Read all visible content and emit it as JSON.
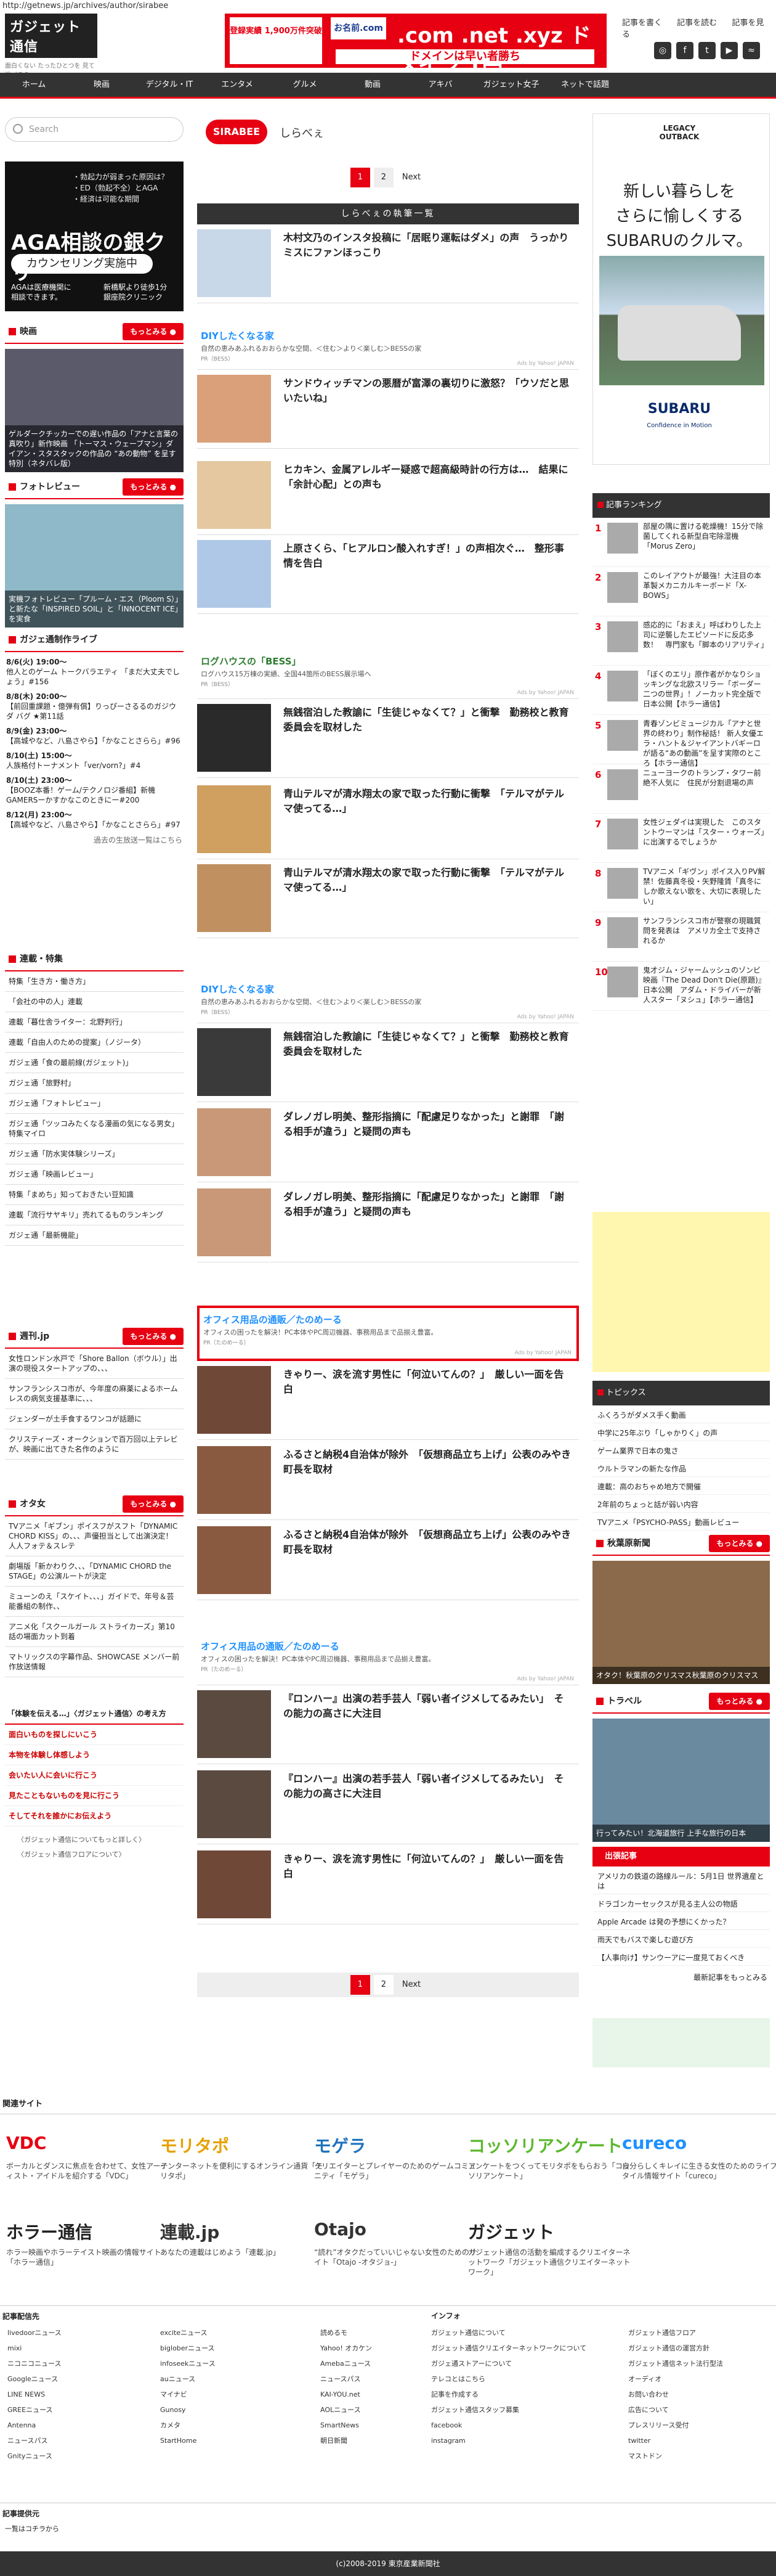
{
  "url": "http://getnews.jp/archives/author/sirabee",
  "logo": {
    "name": "ガジェット通信",
    "tagline": "面白くない たったひとつを 見て過ごそう"
  },
  "top_banner": {
    "left": "登録実績 1,900万件突破",
    "brand": "お名前.com",
    "domains": ".com .net .xyz ドメイン 1円",
    "sub": "ドメインは早い者勝ち"
  },
  "top_links": [
    "記事を書く",
    "記事を読む",
    "記事を見る"
  ],
  "social": [
    "instagram",
    "facebook",
    "twitter",
    "feed"
  ],
  "nav": [
    "ホーム",
    "映画",
    "デジタル・IT",
    "エンタメ",
    "グルメ",
    "動画",
    "アキバ",
    "ガジェット女子",
    "ネットで話題"
  ],
  "search_placeholder": "Search",
  "ad_left": {
    "lines": "・勃起力が弱まった原因は？\n・ED（勃起不全）とAGA\n・経済は可能な期間",
    "title": "AGA相談の銀クリ",
    "button": "カウンセリング実施中",
    "bottom_left": "AGAは医療機関に\n相談できます。",
    "bottom_right": "新橋駅より徒歩1分\n銀座院クリニック"
  },
  "left": {
    "movie_hdr": "映画",
    "more": "もっとみる",
    "movie_cap": "ゲルダークチッカーでの遅い作品の「アナと言葉の真吹り」新作映画 「トーマス・ウェーブマン」ダイアン・スタスタックの作品の “あの動物” を呈す 特別（ネタバレ版）",
    "photo_hdr": "フォトレビュー",
    "photo_cap": "実機フォトレビュー「プルーム・エス（Ploom S）」と新たな「INSPIRED SOIL」と「INNOCENT ICE」を実食",
    "live_hdr": "ガジェ通制作ライブ",
    "live": [
      {
        "d": "8/6(火) 19:00〜",
        "t": "他人とのゲーム トークバラエティ 「まだ大丈夫でしょう」#156"
      },
      {
        "d": "8/8(木) 20:00〜",
        "t": "【前回重課題・億弾有償】りっぴーさるるのガジウダ バグ ★第11話"
      },
      {
        "d": "8/9(金) 23:00〜",
        "t": "【高城やなど、八島さやら】「かなことさらら」#96"
      },
      {
        "d": "8/10(土) 15:00〜",
        "t": "人族格付トーナメント「ver/vorn?」#4"
      },
      {
        "d": "8/10(土) 23:00〜",
        "t": "【BOOZ本番！ゲーム/テクノロジ番組】新機 GAMERSーかすかなこのときにー#200"
      },
      {
        "d": "8/12(月) 23:00〜",
        "t": "【高城やなど、八島さやら】「かなことさらら」#97"
      }
    ],
    "live_more": "過去の生放送一覧はこちら",
    "series_hdr": "連載・特集",
    "series": [
      "特集「生き方・働き方」",
      "「会社の中の人」連載",
      "連載「暮仕舎ライター：北野判行」",
      "連載「自由人のための提案」（ノジータ）",
      "ガジェ通「食の最前線(ガジェット)」",
      "ガジェ通「旅野村」",
      "ガジェ通「フォトレビュー」",
      "ガジェ通「ツッコみたくなる漫画の気になる男女」特集マイロ",
      "ガジェ通「防水実体験シリーズ」",
      "ガジェ通「映画レビュー」",
      "特集「まめち」知っておきたい豆知識",
      "連載「流行サヤキリ」売れてるものランキング",
      "ガジェ通「最新機能」"
    ],
    "news_hdr": "週刊.jp",
    "news": [
      "女性ロンドン水戸で「Shore Ballon（ボウル）」出演の現役スタートアップの、、、",
      "サンフランシスコ市が、今年度の麻薬によるホームレスの病気支援基準に、、、",
      "ジェンダーが土手食するワンコが話題に",
      "クリスティーズ・オークションで百万回以上テレビが、映画に出てきた名作のように"
    ],
    "otaku_hdr": "オタ女",
    "otaku": [
      "TVアニメ「ギブン」ポイスフがスフト「DYNAMIC CHORD KISS」の、、、声優担当として出演決定！人人フォテ＆スレテ",
      "劇場版「新かわりク、、、「DYNAMIC CHORD the STAGE」の公演ルートが決定",
      "ミューンのえ「スケイト、、、」ガイドで、年号＆芸能番組の制作、、",
      "アニメ化「スクールガール ストライカーズ」第10話の場面カット到着",
      "マトリックスの字幕作品、SHOWCASE メンバー前作放送情報"
    ],
    "reason_hdr": "「体験を伝える…」〈ガジェット通信〉の考え方",
    "reason": [
      "面白いものを探しにいこう",
      "本物を体験し体感しよう",
      "会いたい人に会いに行こう",
      "見たこともないものを見に行こう",
      "そしてそれを誰かにお伝えよう"
    ],
    "more_links": [
      "〈ガジェット通信についてもっと詳しく〉",
      "〈ガジェット通信フロアについて〉"
    ]
  },
  "center": {
    "sirabee_logo": "SIRABEE",
    "sirabee_name": "しらべぇ",
    "pager": {
      "cur": "1",
      "p2": "2",
      "next": "Next"
    },
    "author_title": "しらべぇの執筆一覧",
    "ad1": {
      "title": "DIYしたくなる家",
      "desc": "自然の恵みあふれるおおらかな空間、＜住む＞より＜楽しむ＞BESSの家",
      "sponsor": "PR（BESS）",
      "adtag": "Ads by Yahoo! JAPAN"
    },
    "ad2": {
      "title": "ログハウスの「BESS」",
      "desc": "ログハウス15万棟の実績、全国44箇所のBESS展示場へ",
      "sponsor": "PR（BESS）",
      "adtag": "Ads by Yahoo! JAPAN"
    },
    "ad3": {
      "title": "DIYしたくなる家",
      "desc": "自然の恵みあふれるおおらかな空間、＜住む＞より＜楽しむ＞BESSの家",
      "sponsor": "PR（BESS）",
      "adtag": "Ads by Yahoo! JAPAN"
    },
    "ad4": {
      "title": "オフィス用品の通販／たのめーる",
      "desc": "オフィスの困ったを解決！PC本体やPC周辺機器、事務用品まで品揃え豊富。",
      "sponsor": "PR（たのめーる）",
      "adtag": "Ads by Yahoo! JAPAN"
    },
    "ad5": {
      "title": "オフィス用品の通販／たのめーる",
      "desc": "オフィスの困ったを解決！PC本体やPC周辺機器、事務用品まで品揃え豊富。",
      "sponsor": "PR（たのめーる）",
      "adtag": "Ads by Yahoo! JAPAN"
    },
    "articles": [
      "木村文乃のインスタ投稿に「居眠り運転はダメ」の声　うっかりミスにファンほっこり",
      "サンドウィッチマンの悪暦が富澤の裏切りに激怒？「ウソだと思いたいね」",
      "ヒカキン、金属アレルギー疑惑で超高級時計の行方は…　結果に「余計心配」との声も",
      "上原さくら、「ヒアルロン酸入れすぎ！」の声相次ぐ…　整形事情を告白",
      "無銭宿泊した教諭に「生徒じゃなくて？」と衝撃　勤務校と教育委員会を取材した",
      "青山テルマが清水翔太の家で取った行動に衝撃　「テルマがテルマ使ってる…」",
      "青山テルマが清水翔太の家で取った行動に衝撃　「テルマがテルマ使ってる…」",
      "無銭宿泊した教諭に「生徒じゃなくて？」と衝撃　勤務校と教育委員会を取材した",
      "ダレノガレ明美、整形指摘に「配慮足りなかった」と謝罪　「謝る相手が違う」と疑問の声も",
      "ダレノガレ明美、整形指摘に「配慮足りなかった」と謝罪　「謝る相手が違う」と疑問の声も",
      "きゃりー、涙を流す男性に「何泣いてんの？」　厳しい一面を告白",
      "ふるさと納税4自治体が除外　「仮想商品立ち上げ」公表のみやき町長を取材",
      "ふるさと納税4自治体が除外　「仮想商品立ち上げ」公表のみやき町長を取材",
      "『ロンハー』出演の若手芸人「弱い者イジメしてるみたい」　その能力の高さに大注目",
      "『ロンハー』出演の若手芸人「弱い者イジメしてるみたい」　その能力の高さに大注目",
      "きゃりー、涙を流す男性に「何泣いてんの？」　厳しい一面を告白"
    ]
  },
  "right": {
    "ad": {
      "top": "LEGACY OUTBACK",
      "main": "新しい暮らしを\nさらに愉しくする\nSUBARUのクルマ。",
      "brand": "SUBARU",
      "slogan": "Confidence in Motion"
    },
    "rank_hdr": "記事ランキング",
    "ranking": [
      "部屋の隅に置ける乾燥機！15分で除菌してくれる新型自宅除湿機「Morus Zero」",
      "このレイアウトが最強！大注目の本革製メカニカルキーボード「X-BOWS」",
      "感応的に「おまえ」呼ばわりした上司に逆襲したエピソードに反応多数！　専門家も「脚本のリアリティ」",
      "「ぼくのエリ」原作者がかなりショッキングな北欧スリラー「ボーダー　二つの世界」！ノーカット完全版で日本公開【ホラー通信】",
      "青春ゾンビミュージカル「アナと世界の終わり」制作秘話！ 新人女優エラ・ハント＆ジャイアントバギーロが語る“あの動画”を呈す実際のところ【ホラー通信】",
      "ニューヨークのトランプ・タワー前絶不人気に　住民が分割退場の声",
      "女性ジェダイは実現した　このスタントウーマンは「スター・ウォーズ」に出演するでしょうか",
      "TVアニメ「ギヴン」ポイス入りPV解禁！佐藤真冬役・矢野隆賃「真冬にしか歌えない歌を、大切に表現したい」",
      "サンフランシスコ市が警察の現職質問を発表は　アメリカ全土で支持されるか",
      "鬼才ジム・ジャームッシュのゾンビ映画『The Dead Don't Die(原題)』日本公開　アダム・ドライバーが新人スター「ヌシュ」【ホラー通信】"
    ],
    "topics_hdr": "トピックス",
    "topics": [
      "ふくろうがダメス手く動画",
      "中学に25年ぶり「しゃかりく」の声",
      "ゲーム業界で日本の鬼さ",
      "ウルトラマンの新たな作品",
      "連載：高のおちゃめ地方で開催",
      "2年前のちょっと話が弱い内容",
      "TVアニメ「PSYCHO-PASS」動画レビュー"
    ],
    "akiba_hdr": "秋葉原新聞",
    "akiba_cap": "オタク！秋葉原のクリスマス秋葉原のクリスマス",
    "travel_hdr": "トラベル",
    "travel_cap": "行ってみたい！北海道旅行 上手な旅行の日本",
    "links_hdr": "出張記事",
    "links": [
      "アメリカの鉄道の路線ルール：5月1日 世界遺産とは",
      "ドラゴンカーセックスが見る主人公の物語",
      "Apple Arcade は発の予想にくかった？",
      "雨天でもバスで楽しむ遊び方",
      "【人事向け】サンウーアに一度見ておくべき"
    ],
    "more_big": "最新記事をもっとみる"
  },
  "footer": {
    "related_hdr": "関連サイト",
    "sites": [
      {
        "logo": "VDC",
        "desc": "ボーカルとダンスに焦点を合わせて、女性アーティスト・アイドルを紹介する「VDC」"
      },
      {
        "logo": "モリタポ",
        "desc": "インターネットを便利にするオンライン通貨「モリタポ」"
      },
      {
        "logo": "モゲラ",
        "desc": "クリエイターとプレイヤーのためのゲームコミュニティ「モゲラ」"
      },
      {
        "logo": "コッソリアンケート",
        "desc": "アンケートをつくってモリタポをもらおう「コッソリアンケート」"
      },
      {
        "logo": "cureco",
        "desc": "自分らしくキレイに生きる女性のためのライフスタイル情報サイト「cureco」"
      },
      {
        "logo": "ホラー通信",
        "desc": "ホラー映画やホラーテイスト映画の情報サイト「ホラー通信」"
      },
      {
        "logo": "連載.jp",
        "desc": "あなたの連載はじめよう「連載.jp」"
      },
      {
        "logo": "Otajo",
        "desc": "“読れ”オタクだっていいじゃない女性のためのサイト「Otajo -オタジョ-」"
      },
      {
        "logo": "ガジェット",
        "desc": "ガジェット通信の活動を編成するクリエイターネットワーク「ガジェット通信クリエイターネットワーク」"
      }
    ],
    "dist_hdr": "記事配信先",
    "dist1": [
      "livedoorニュース",
      "mixi",
      "ニコニコニュース",
      "Googleニュース",
      "LINE NEWS",
      "GREEニュース",
      "Antenna",
      "ニュースパス",
      "Gnityニュース"
    ],
    "dist2": [
      "exciteニュース",
      "bigloberニュース",
      "infoseekニュース",
      "auニュース",
      "マイナビ",
      "Gunosy",
      "カメタ",
      "StartHome"
    ],
    "dist3": [
      "読めるモ",
      "Yahoo! オカケン",
      "Amebaニュース",
      "ニュースパス",
      "KAI-YOU.net",
      "AOLニュース",
      "SmartNews",
      "朝日新聞"
    ],
    "info_hdr": "インフォ",
    "info1": [
      "ガジェット通信について",
      "ガジェット通信クリエイターネットワークについて",
      "ガジェ通ストアーについて",
      "テレコとはこちら",
      "記事を作成する",
      "ガジェット通信スタッフ募集",
      "facebook",
      "instagram"
    ],
    "info2": [
      "ガジェット通信フロア",
      "ガジェット通信の運営方針",
      "ガジェット通信ネット法行型法",
      "オーディオ",
      "お問い合わせ",
      "広告について",
      "プレスリリース受付",
      "twitter",
      "マストドン"
    ],
    "write_hdr": "記事提供元",
    "write_link": "一覧はコチラから",
    "copyright": "(c)2008-2019 東京産業新聞社"
  }
}
